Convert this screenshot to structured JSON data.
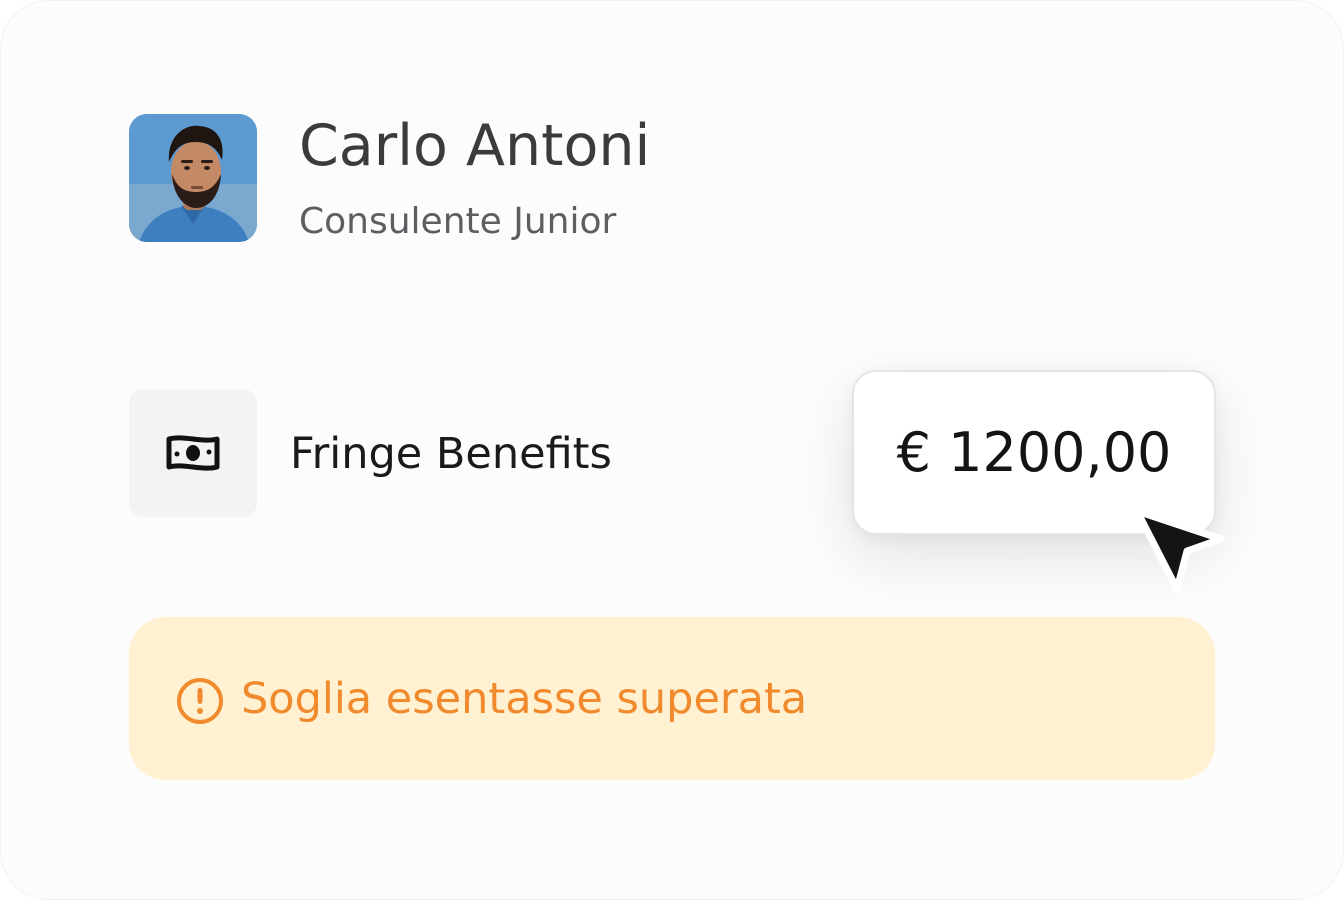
{
  "profile": {
    "name": "Carlo Antoni",
    "role": "Consulente Junior"
  },
  "benefit": {
    "label": "Fringe Benefits",
    "icon": "banknote-icon",
    "amount": "€ 1200,00"
  },
  "warning": {
    "icon": "alert-circle-icon",
    "text": "Soglia esentasse superata"
  },
  "colors": {
    "warning_background": "#fff1d2",
    "warning_text": "#f08a2c",
    "icon_box_background": "#f3f3f3"
  }
}
